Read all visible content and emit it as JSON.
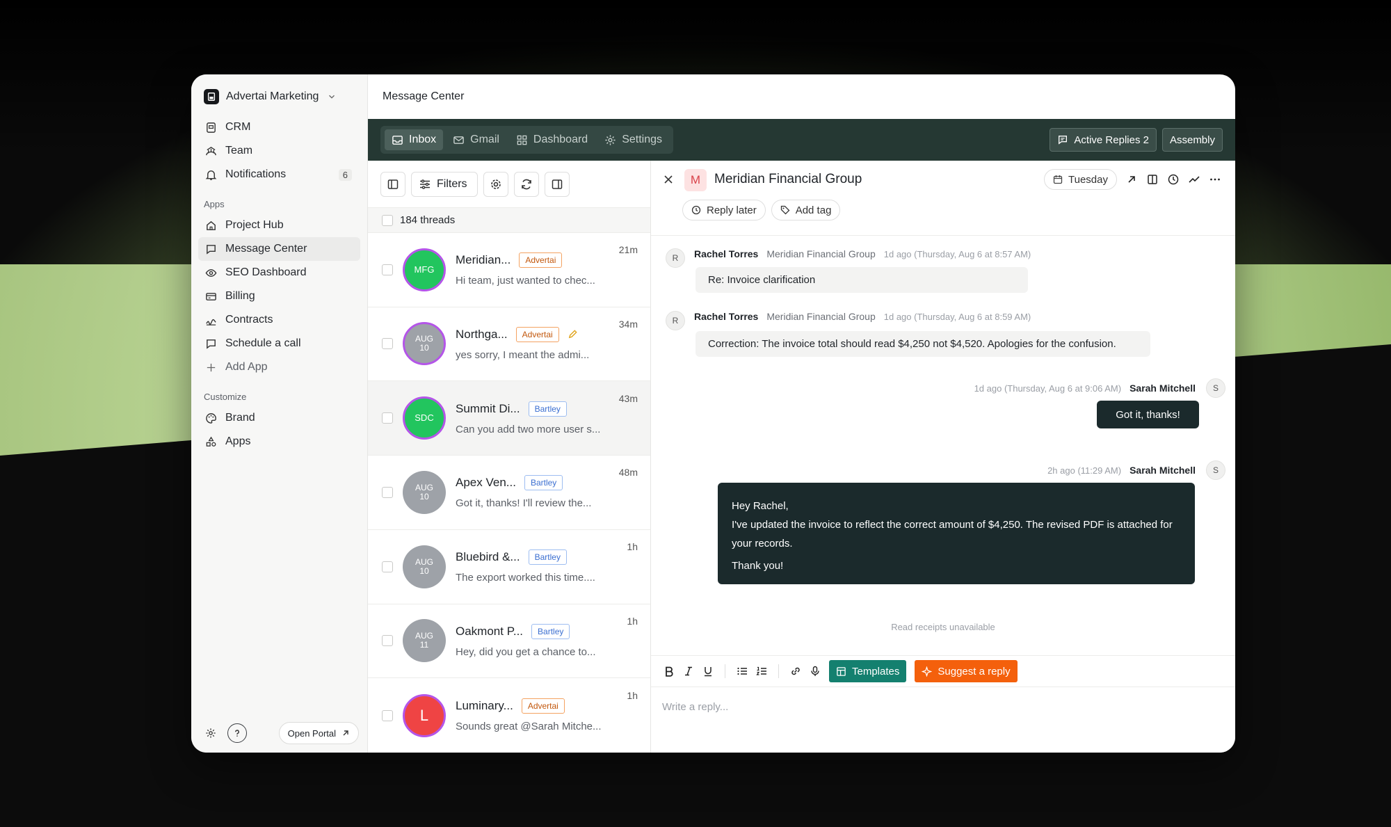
{
  "colors": {
    "dark_bar": "#253833",
    "accent_green": "#14806f",
    "accent_orange": "#f4600c",
    "outgoing_bubble": "#1b2a2c"
  },
  "sidebar": {
    "workspace": "Advertai Marketing",
    "top_items": [
      {
        "label": "CRM",
        "icon": "crm-icon"
      },
      {
        "label": "Team",
        "icon": "team-icon"
      },
      {
        "label": "Notifications",
        "icon": "bell-icon",
        "count": "6"
      }
    ],
    "apps_label": "Apps",
    "apps": [
      {
        "label": "Project Hub",
        "icon": "home-icon"
      },
      {
        "label": "Message Center",
        "icon": "chat-icon",
        "active": true
      },
      {
        "label": "SEO Dashboard",
        "icon": "eye-icon"
      },
      {
        "label": "Billing",
        "icon": "billing-icon"
      },
      {
        "label": "Contracts",
        "icon": "contracts-icon"
      },
      {
        "label": "Schedule a call",
        "icon": "chat-icon"
      }
    ],
    "add_app": "Add App",
    "customize_label": "Customize",
    "customize": [
      {
        "label": "Brand",
        "icon": "palette-icon"
      },
      {
        "label": "Apps",
        "icon": "apps-icon"
      }
    ],
    "open_portal": "Open Portal"
  },
  "header": {
    "title": "Message Center"
  },
  "tabs": [
    {
      "label": "Inbox",
      "active": true
    },
    {
      "label": "Gmail"
    },
    {
      "label": "Dashboard"
    },
    {
      "label": "Settings"
    }
  ],
  "top_actions": {
    "active_replies": "Active Replies 2",
    "assembly": "Assembly"
  },
  "thread_list": {
    "filters_label": "Filters",
    "count_label": "184 threads",
    "threads": [
      {
        "name": "Meridian...",
        "tag": "Advertai",
        "tag_color": "orange",
        "time": "21m",
        "preview": "Hi team, just wanted to chec...",
        "avatar": "MFG",
        "avatar_color": "green",
        "ring": true
      },
      {
        "name": "Northga...",
        "tag": "Advertai",
        "tag_color": "orange",
        "time": "34m",
        "preview": "yes sorry, I meant the admi...",
        "avatar_top": "AUG",
        "avatar_bottom": "10",
        "avatar_color": "gray",
        "ring": true,
        "pencil": true
      },
      {
        "name": "Summit Di...",
        "tag": "Bartley",
        "tag_color": "blue",
        "time": "43m",
        "preview": "Can you add two more user s...",
        "avatar": "SDC",
        "avatar_color": "green",
        "ring": true,
        "selected": true
      },
      {
        "name": "Apex Ven...",
        "tag": "Bartley",
        "tag_color": "blue",
        "time": "48m",
        "preview": "Got it, thanks! I'll review the...",
        "avatar_top": "AUG",
        "avatar_bottom": "10",
        "avatar_color": "gray"
      },
      {
        "name": "Bluebird &...",
        "tag": "Bartley",
        "tag_color": "blue",
        "time": "1h",
        "preview": "The export worked this time....",
        "avatar_top": "AUG",
        "avatar_bottom": "10",
        "avatar_color": "gray"
      },
      {
        "name": "Oakmont P...",
        "tag": "Bartley",
        "tag_color": "blue",
        "time": "1h",
        "preview": "Hey, did you get a chance to...",
        "avatar_top": "AUG",
        "avatar_bottom": "11",
        "avatar_color": "gray"
      },
      {
        "name": "Luminary...",
        "tag": "Advertai",
        "tag_color": "orange",
        "time": "1h",
        "preview": "Sounds great @Sarah Mitche...",
        "avatar": "L",
        "avatar_color": "red",
        "ring": true
      }
    ]
  },
  "conversation": {
    "avatar_letter": "M",
    "title": "Meridian Financial Group",
    "date_pill": "Tuesday",
    "reply_later": "Reply later",
    "add_tag": "Add tag",
    "messages": [
      {
        "avatar": "R",
        "sender": "Rachel Torres",
        "org": "Meridian Financial Group",
        "when": "1d ago (Thursday, Aug 6 at 8:57 AM)",
        "text": "Re: Invoice clarification"
      },
      {
        "avatar": "R",
        "sender": "Rachel Torres",
        "org": "Meridian Financial Group",
        "when": "1d ago (Thursday, Aug 6 at 8:59 AM)",
        "text": "Correction: The invoice total should read $4,250 not $4,520. Apologies for the confusion."
      },
      {
        "avatar": "S",
        "sender": "Sarah Mitchell",
        "when": "1d ago (Thursday, Aug 6 at 9:06 AM)",
        "text": "Got it, thanks!"
      },
      {
        "avatar": "S",
        "sender": "Sarah Mitchell",
        "when": "2h ago (11:29 AM)",
        "lines": [
          "Hey Rachel,",
          "I've updated the invoice to reflect the correct amount of $4,250. The revised PDF is attached for",
          "your records.",
          "Thank you!"
        ]
      }
    ],
    "read_receipts": "Read receipts unavailable"
  },
  "composer": {
    "templates": "Templates",
    "suggest": "Suggest a reply",
    "placeholder": "Write a reply..."
  }
}
